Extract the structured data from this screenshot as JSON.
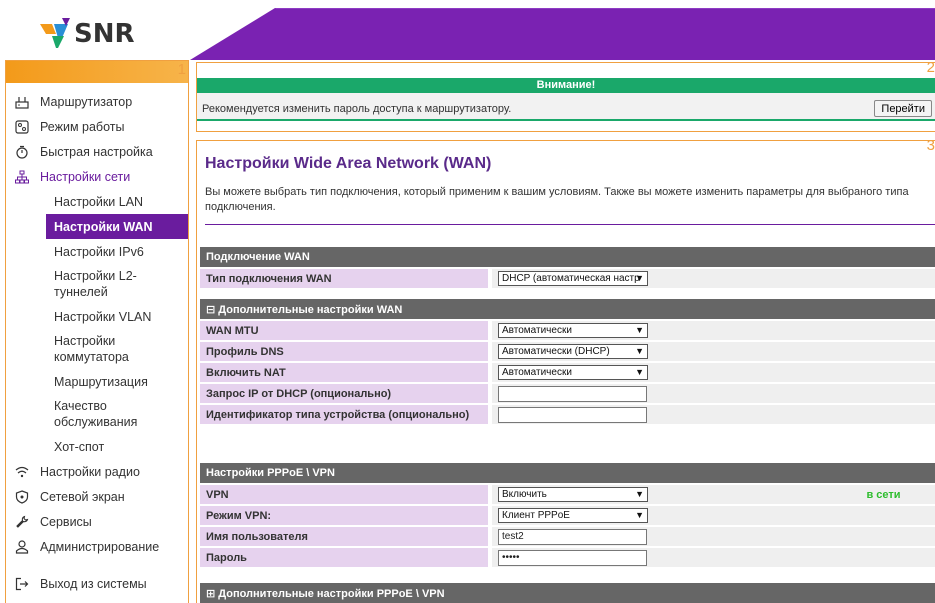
{
  "brand": {
    "name": "SNR",
    "colors": {
      "purple": "#6a1c9e",
      "orange": "#f39a1a",
      "green": "#1aa86a",
      "blue": "#2a8fd6"
    }
  },
  "frames": {
    "nav": "1",
    "notice": "2",
    "main": "3"
  },
  "sidebar": {
    "items": [
      {
        "icon": "router-icon",
        "label": "Маршрутизатор"
      },
      {
        "icon": "mode-icon",
        "label": "Режим работы"
      },
      {
        "icon": "stopwatch-icon",
        "label": "Быстрая настройка"
      },
      {
        "icon": "network-icon",
        "label": "Настройки сети"
      },
      {
        "label": "Настройки LAN"
      },
      {
        "label": "Настройки WAN"
      },
      {
        "label": "Настройки IPv6"
      },
      {
        "label": "Настройки L2-туннелей"
      },
      {
        "label": "Настройки VLAN"
      },
      {
        "label": "Настройки коммутатора"
      },
      {
        "label": "Маршрутизация"
      },
      {
        "label": "Качество обслуживания"
      },
      {
        "label": "Хот-спот"
      },
      {
        "icon": "wifi-icon",
        "label": "Настройки радио"
      },
      {
        "icon": "shield-icon",
        "label": "Сетевой экран"
      },
      {
        "icon": "wrench-icon",
        "label": "Сервисы"
      },
      {
        "icon": "admin-icon",
        "label": "Администрирование"
      },
      {
        "icon": "logout-icon",
        "label": "Выход из системы"
      }
    ]
  },
  "notice": {
    "title": "Внимание!",
    "text": "Рекомендуется изменить пароль доступа к маршрутизатору.",
    "button": "Перейти"
  },
  "main": {
    "title": "Настройки Wide Area Network (WAN)",
    "description": "Вы можете выбрать тип подключения, который применим к вашим условиям. Также вы можете изменить параметры для выбраного типа подключения.",
    "sections": {
      "wan": {
        "header": "Подключение WAN",
        "type_label": "Тип подключения WAN",
        "type_value": "DHCP (автоматическая настр"
      },
      "wan_advanced": {
        "header": "⊟ Дополнительные настройки WAN",
        "rows": [
          {
            "label": "WAN MTU",
            "kind": "select",
            "value": "Автоматически"
          },
          {
            "label": "Профиль DNS",
            "kind": "select",
            "value": "Автоматически (DHCP)"
          },
          {
            "label": "Включить NAT",
            "kind": "select",
            "value": "Автоматически"
          },
          {
            "label": "Запрос IP от DHCP (опционально)",
            "kind": "input",
            "value": ""
          },
          {
            "label": "Идентификатор типа устройства (опционально)",
            "kind": "input",
            "value": ""
          }
        ]
      },
      "pppoe": {
        "header": "Настройки PPPoE \\ VPN",
        "rows": [
          {
            "label": "VPN",
            "kind": "select",
            "value": "Включить",
            "status": "в сети"
          },
          {
            "label": "Режим VPN:",
            "kind": "select",
            "value": "Клиент PPPoE"
          },
          {
            "label": "Имя пользователя",
            "kind": "input",
            "value": "test2"
          },
          {
            "label": "Пароль",
            "kind": "input",
            "value": "•••••"
          }
        ]
      },
      "pppoe_advanced": {
        "header": "⊞ Дополнительные настройки PPPoE \\ VPN"
      }
    }
  }
}
